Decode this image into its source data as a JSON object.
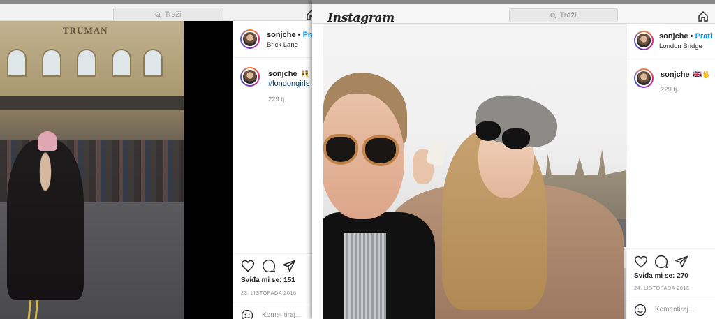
{
  "back_window": {
    "search_placeholder": "Traži",
    "post": {
      "username": "sonjche",
      "dot": "•",
      "follow_label": "Prati",
      "location": "Brick Lane",
      "caption_user": "sonjche",
      "caption_emoji": "👯",
      "caption_suffix": "@",
      "hashtag": "#londongirls",
      "time_ago": "229 tj.",
      "likes": "Sviđa mi se: 151",
      "date": "23. LISTOPADA 2016",
      "comment_placeholder": "Komentiraj..."
    }
  },
  "front_window": {
    "logo": "Instagram",
    "search_placeholder": "Traži",
    "post": {
      "username": "sonjche",
      "dot": "•",
      "follow_label": "Prati",
      "location": "London Bridge",
      "caption_user": "sonjche",
      "caption_emoji": "🇬🇧🖖",
      "time_ago": "229 tj.",
      "likes": "Sviđa mi se: 270",
      "date": "24. LISTOPADA 2016",
      "comment_placeholder": "Komentiraj..."
    },
    "prev_arrow": "‹"
  },
  "colors": {
    "link_blue": "#0095f6",
    "hashtag": "#00376b",
    "text": "#262626",
    "muted": "#8e8e8e"
  },
  "icons": [
    "search-icon",
    "home-icon",
    "heart-icon",
    "comment-icon",
    "share-icon",
    "smile-icon"
  ]
}
